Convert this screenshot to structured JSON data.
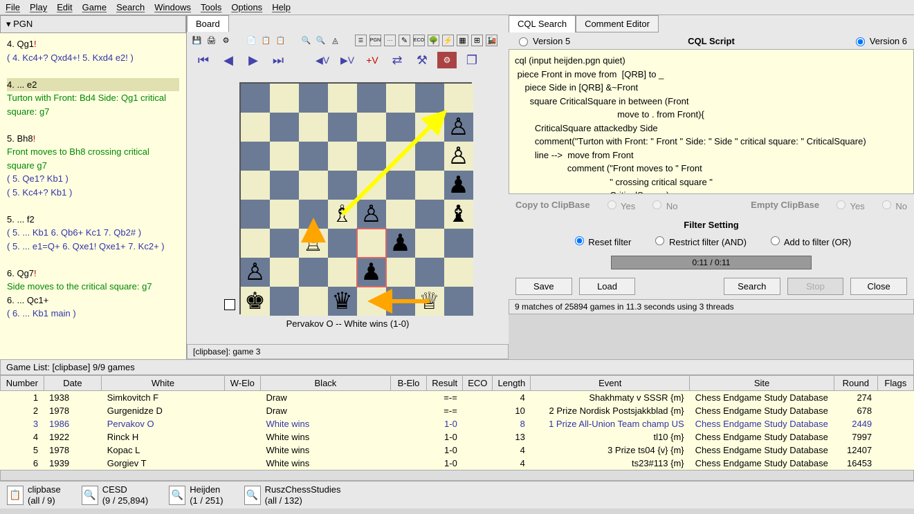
{
  "menubar": [
    "File",
    "Play",
    "Edit",
    "Game",
    "Search",
    "Windows",
    "Tools",
    "Options",
    "Help"
  ],
  "pgn": {
    "header": "▾ PGN",
    "lines": [
      {
        "type": "move",
        "text": "  4.  Qg1",
        "suffix": "!"
      },
      {
        "type": "variation",
        "text": "( 4. Kc4+? Qxd4+! 5. Kxd4 e2! )"
      },
      {
        "type": "blank",
        "text": " "
      },
      {
        "type": "move-highlight",
        "text": "  4.  ...              e2"
      },
      {
        "type": "comment-green",
        "text": "Turton with Front: Bd4 Side: Qg1 critical square: g7"
      },
      {
        "type": "blank",
        "text": " "
      },
      {
        "type": "move",
        "text": "  5.  Bh8",
        "suffix": "!"
      },
      {
        "type": "comment-green",
        "text": "Front moves to Bh8 crossing critical square g7"
      },
      {
        "type": "variation",
        "text": "( 5. Qe1? Kb1 )"
      },
      {
        "type": "variation",
        "text": "( 5. Kc4+? Kb1 )"
      },
      {
        "type": "blank",
        "text": " "
      },
      {
        "type": "move",
        "text": "  5.  ...              f2"
      },
      {
        "type": "variation",
        "text": "( 5. ... Kb1 6. Qb6+ Kc1 7. Qb2# )"
      },
      {
        "type": "variation",
        "text": "( 5. ... e1=Q+ 6. Qxe1! Qxe1+ 7. Kc2+ )"
      },
      {
        "type": "blank",
        "text": " "
      },
      {
        "type": "move",
        "text": "  6.  Qg7",
        "suffix": "!"
      },
      {
        "type": "comment-green",
        "text": "Side moves to the critical square: g7"
      },
      {
        "type": "move",
        "text": "  6.  ...              Qc1+"
      },
      {
        "type": "variation",
        "text": "( 6. ... Kb1 main )"
      }
    ]
  },
  "board_tab": "Board",
  "board": {
    "caption": "Pervakov O   --   White wins  (1-0)",
    "clipbase": "[clipbase]: game  3",
    "pieces": [
      {
        "sq": "h7",
        "u": "♙"
      },
      {
        "sq": "h6",
        "u": "♙"
      },
      {
        "sq": "h5",
        "u": "♟"
      },
      {
        "sq": "h4",
        "u": "♝"
      },
      {
        "sq": "d4",
        "u": "♗"
      },
      {
        "sq": "e4",
        "u": "♙"
      },
      {
        "sq": "c3",
        "u": "♖"
      },
      {
        "sq": "f3",
        "u": "♟"
      },
      {
        "sq": "a2",
        "u": "♙"
      },
      {
        "sq": "e2",
        "u": "♟"
      },
      {
        "sq": "a1",
        "u": "♚"
      },
      {
        "sq": "d1",
        "u": "♛"
      },
      {
        "sq": "g1",
        "u": "♕"
      }
    ]
  },
  "cql": {
    "tab1": "CQL Search",
    "tab2": "Comment Editor",
    "version5": "Version 5",
    "version6": "Version 6",
    "title": "CQL Script",
    "script": "cql (input heijden.pgn quiet)\n piece Front in move from  [QRB] to _\n    piece Side in [QRB] &~Front\n      square CriticalSquare in between (Front\n                                         move to . from Front){\n        CriticalSquare attackedby Side\n        comment(\"Turton with Front: \" Front \" Side: \" Side \" critical square: \" CriticalSquare)\n        line -->  move from Front\n                     comment (\"Front moves to \" Front\n                                      \" crossing critical square \"\n                                      CriticalSquare)",
    "copy_label": "Copy to ClipBase",
    "empty_label": "Empty ClipBase",
    "yes": "Yes",
    "no": "No",
    "filter_title": "Filter Setting",
    "filter_reset": "Reset filter",
    "filter_restrict": "Restrict filter (AND)",
    "filter_add": "Add to filter (OR)",
    "progress": "0:11 / 0:11",
    "btn_save": "Save",
    "btn_load": "Load",
    "btn_search": "Search",
    "btn_stop": "Stop",
    "btn_close": "Close",
    "status": "9 matches of 25894 games in 11.3 seconds using 3 threads"
  },
  "gamelist": {
    "header": "Game List: [clipbase] 9/9 games",
    "columns": [
      "Number",
      "Date",
      "White",
      "W-Elo",
      "Black",
      "B-Elo",
      "Result",
      "ECO",
      "Length",
      "Event",
      "Site",
      "Round",
      "Flags"
    ],
    "rows": [
      {
        "n": "1",
        "date": "1938",
        "white": "Simkovitch F",
        "black": "Draw",
        "result": "=-=",
        "len": "4",
        "event": "Shakhmaty v SSSR {m}",
        "site": "Chess Endgame Study Database",
        "round": "274",
        "sel": false
      },
      {
        "n": "2",
        "date": "1978",
        "white": "Gurgenidze D",
        "black": "Draw",
        "result": "=-=",
        "len": "10",
        "event": "2 Prize Nordisk Postsjakkblad {m}",
        "site": "Chess Endgame Study Database",
        "round": "678",
        "sel": false
      },
      {
        "n": "3",
        "date": "1986",
        "white": "Pervakov O",
        "black": "White wins",
        "result": "1-0",
        "len": "8",
        "event": "1 Prize All-Union Team champ US",
        "site": "Chess Endgame Study Database",
        "round": "2449",
        "sel": true
      },
      {
        "n": "4",
        "date": "1922",
        "white": "Rinck H",
        "black": "White wins",
        "result": "1-0",
        "len": "13",
        "event": "tl10 {m}",
        "site": "Chess Endgame Study Database",
        "round": "7997",
        "sel": false
      },
      {
        "n": "5",
        "date": "1978",
        "white": "Kopac L",
        "black": "White wins",
        "result": "1-0",
        "len": "4",
        "event": "3 Prize ts04 {v} {m}",
        "site": "Chess Endgame Study Database",
        "round": "12407",
        "sel": false
      },
      {
        "n": "6",
        "date": "1939",
        "white": "Gorgiev T",
        "black": "White wins",
        "result": "1-0",
        "len": "4",
        "event": "ts23#113 {m}",
        "site": "Chess Endgame Study Database",
        "round": "16453",
        "sel": false
      }
    ]
  },
  "databases": [
    {
      "name": "clipbase",
      "count": "(all / 9)",
      "icon": "📋"
    },
    {
      "name": "CESD",
      "count": "(9 / 25,894)",
      "icon": "🔍"
    },
    {
      "name": "Heijden",
      "count": "(1 / 251)",
      "icon": "🔍"
    },
    {
      "name": "RuszChessStudies",
      "count": "(all / 132)",
      "icon": "🔍"
    }
  ]
}
